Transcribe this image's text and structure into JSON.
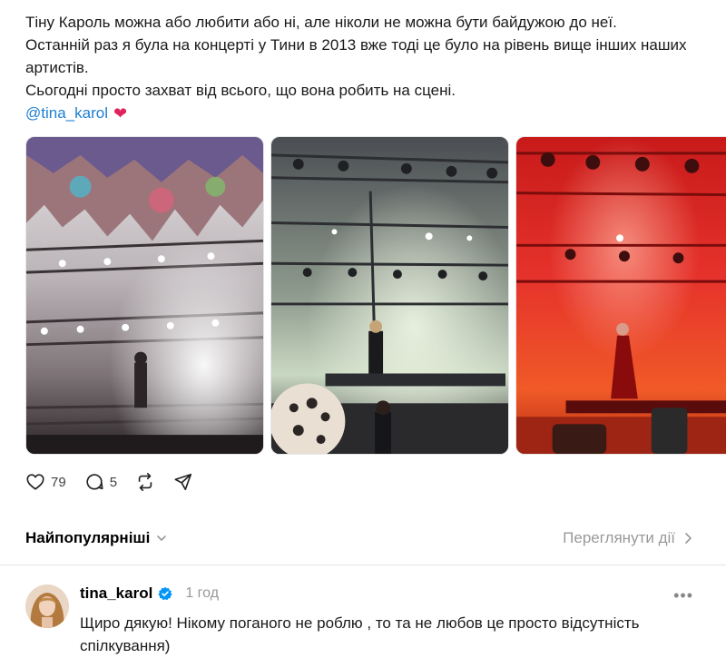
{
  "post": {
    "lines": [
      "Тіну Кароль можна або любити або ні, але ніколи не можна бути байдужою до неї.",
      "Останній раз я була на концерті у Тини в 2013 вже тоді це було на рівень вище інших наших артистів.",
      "Сьогодні просто захват від всього, що вона робить на сцені."
    ],
    "mention": "@tina_karol",
    "emoji": "❤"
  },
  "gallery": {
    "photos": [
      {
        "name": "concert-photo-1",
        "icon": "stage-lights-image"
      },
      {
        "name": "concert-photo-2",
        "icon": "stage-lights-image"
      },
      {
        "name": "concert-photo-3",
        "icon": "red-stage-image"
      }
    ]
  },
  "actions": {
    "likes": "79",
    "replies": "5",
    "icons": [
      "heart-icon",
      "comment-icon",
      "repost-icon",
      "share-icon"
    ]
  },
  "sort": {
    "label": "Найпопулярніші",
    "view_activity": "Переглянути дії"
  },
  "reply": {
    "username": "tina_karol",
    "time": "1 год",
    "text": "Щиро дякую! Нікому поганого не роблю , то та не любов це просто відсутність спілкування)",
    "more": "•••"
  },
  "colors": {
    "mention": "#1d7fd1",
    "heart": "#e0245e",
    "verified": "#0095f6",
    "muted": "#999999"
  }
}
